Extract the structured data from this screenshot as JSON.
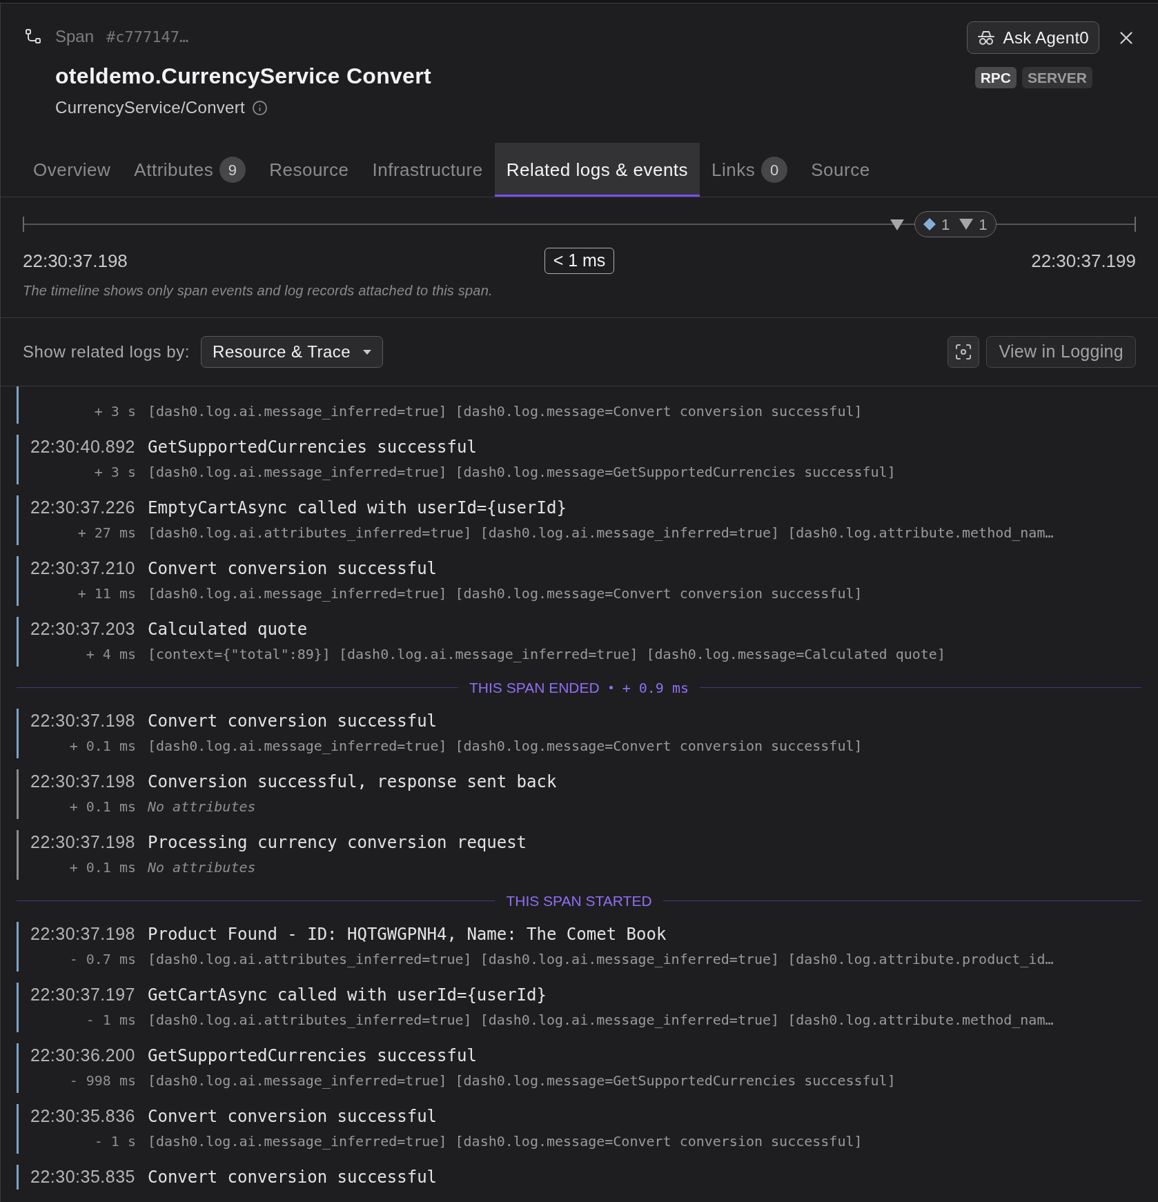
{
  "header": {
    "type_label": "Span",
    "span_id": "#c777147…",
    "title": "oteldemo.CurrencyService Convert",
    "operation": "CurrencyService/Convert",
    "ask_button": "Ask Agent0",
    "badges": [
      {
        "label": "RPC",
        "kind": "protocol"
      },
      {
        "label": "SERVER",
        "kind": "role"
      }
    ]
  },
  "tabs": [
    {
      "label": "Overview",
      "selected": false
    },
    {
      "label": "Attributes",
      "count": "9",
      "selected": false
    },
    {
      "label": "Resource",
      "selected": false
    },
    {
      "label": "Infrastructure",
      "selected": false
    },
    {
      "label": "Related logs & events",
      "selected": true
    },
    {
      "label": "Links",
      "count": "0",
      "selected": false
    },
    {
      "label": "Source",
      "selected": false
    }
  ],
  "timeline": {
    "markers": [
      {
        "kind": "event",
        "count": "1"
      },
      {
        "kind": "log",
        "count": "1"
      }
    ],
    "start": "22:30:37.198",
    "duration": "< 1 ms",
    "end": "22:30:37.199",
    "note": "The timeline shows only span events and log records attached to this span."
  },
  "filter": {
    "label": "Show related logs by:",
    "value": "Resource & Trace",
    "view_button": "View in Logging"
  },
  "entries": [
    {
      "kind": "log",
      "offset": "+ 3 s",
      "attributes": "[dash0.log.ai.message_inferred=true] [dash0.log.message=Convert conversion successful]",
      "color": "#7da3c6"
    },
    {
      "kind": "log",
      "timestamp": "22:30:40.892",
      "message": "GetSupportedCurrencies successful",
      "offset": "+ 3 s",
      "attributes": "[dash0.log.ai.message_inferred=true] [dash0.log.message=GetSupportedCurrencies successful]",
      "color": "#7da3c6"
    },
    {
      "kind": "log",
      "timestamp": "22:30:37.226",
      "message": "EmptyCartAsync called with userId={userId}",
      "offset": "+ 27 ms",
      "attributes": "[dash0.log.ai.attributes_inferred=true] [dash0.log.ai.message_inferred=true] [dash0.log.attribute.method_nam…",
      "color": "#7da3c6"
    },
    {
      "kind": "log",
      "timestamp": "22:30:37.210",
      "message": "Convert conversion successful",
      "offset": "+ 11 ms",
      "attributes": "[dash0.log.ai.message_inferred=true] [dash0.log.message=Convert conversion successful]",
      "color": "#7da3c6"
    },
    {
      "kind": "log",
      "timestamp": "22:30:37.203",
      "message": "Calculated quote",
      "offset": "+ 4 ms",
      "attributes": "[context={\"total\":89}] [dash0.log.ai.message_inferred=true] [dash0.log.message=Calculated quote]",
      "color": "#7da3c6"
    },
    {
      "kind": "separator",
      "label": "THIS SPAN ENDED",
      "offset": "+ 0.9 ms"
    },
    {
      "kind": "log",
      "timestamp": "22:30:37.198",
      "message": "Convert conversion successful",
      "offset": "+ 0.1 ms",
      "attributes": "[dash0.log.ai.message_inferred=true] [dash0.log.message=Convert conversion successful]",
      "color": "#7da3c6"
    },
    {
      "kind": "log",
      "timestamp": "22:30:37.198",
      "message": "Conversion successful, response sent back",
      "offset": "+ 0.1 ms",
      "no_attributes_note": "No attributes",
      "color": "#8a8a8d"
    },
    {
      "kind": "log",
      "timestamp": "22:30:37.198",
      "message": "Processing currency conversion request",
      "offset": "+ 0.1 ms",
      "no_attributes_note": "No attributes",
      "color": "#8a8a8d"
    },
    {
      "kind": "separator",
      "label": "THIS SPAN STARTED"
    },
    {
      "kind": "log",
      "timestamp": "22:30:37.198",
      "message": "Product Found - ID: HQTGWGPNH4, Name: The Comet Book",
      "offset": "- 0.7 ms",
      "attributes": "[dash0.log.ai.attributes_inferred=true] [dash0.log.ai.message_inferred=true] [dash0.log.attribute.product_id…",
      "color": "#7da3c6"
    },
    {
      "kind": "log",
      "timestamp": "22:30:37.197",
      "message": "GetCartAsync called with userId={userId}",
      "offset": "- 1 ms",
      "attributes": "[dash0.log.ai.attributes_inferred=true] [dash0.log.ai.message_inferred=true] [dash0.log.attribute.method_nam…",
      "color": "#7da3c6"
    },
    {
      "kind": "log",
      "timestamp": "22:30:36.200",
      "message": "GetSupportedCurrencies successful",
      "offset": "- 998 ms",
      "attributes": "[dash0.log.ai.message_inferred=true] [dash0.log.message=GetSupportedCurrencies successful]",
      "color": "#7da3c6"
    },
    {
      "kind": "log",
      "timestamp": "22:30:35.836",
      "message": "Convert conversion successful",
      "offset": "- 1 s",
      "attributes": "[dash0.log.ai.message_inferred=true] [dash0.log.message=Convert conversion successful]",
      "color": "#7da3c6"
    },
    {
      "kind": "log",
      "timestamp": "22:30:35.835",
      "message": "Convert conversion successful",
      "color": "#7da3c6"
    }
  ]
}
